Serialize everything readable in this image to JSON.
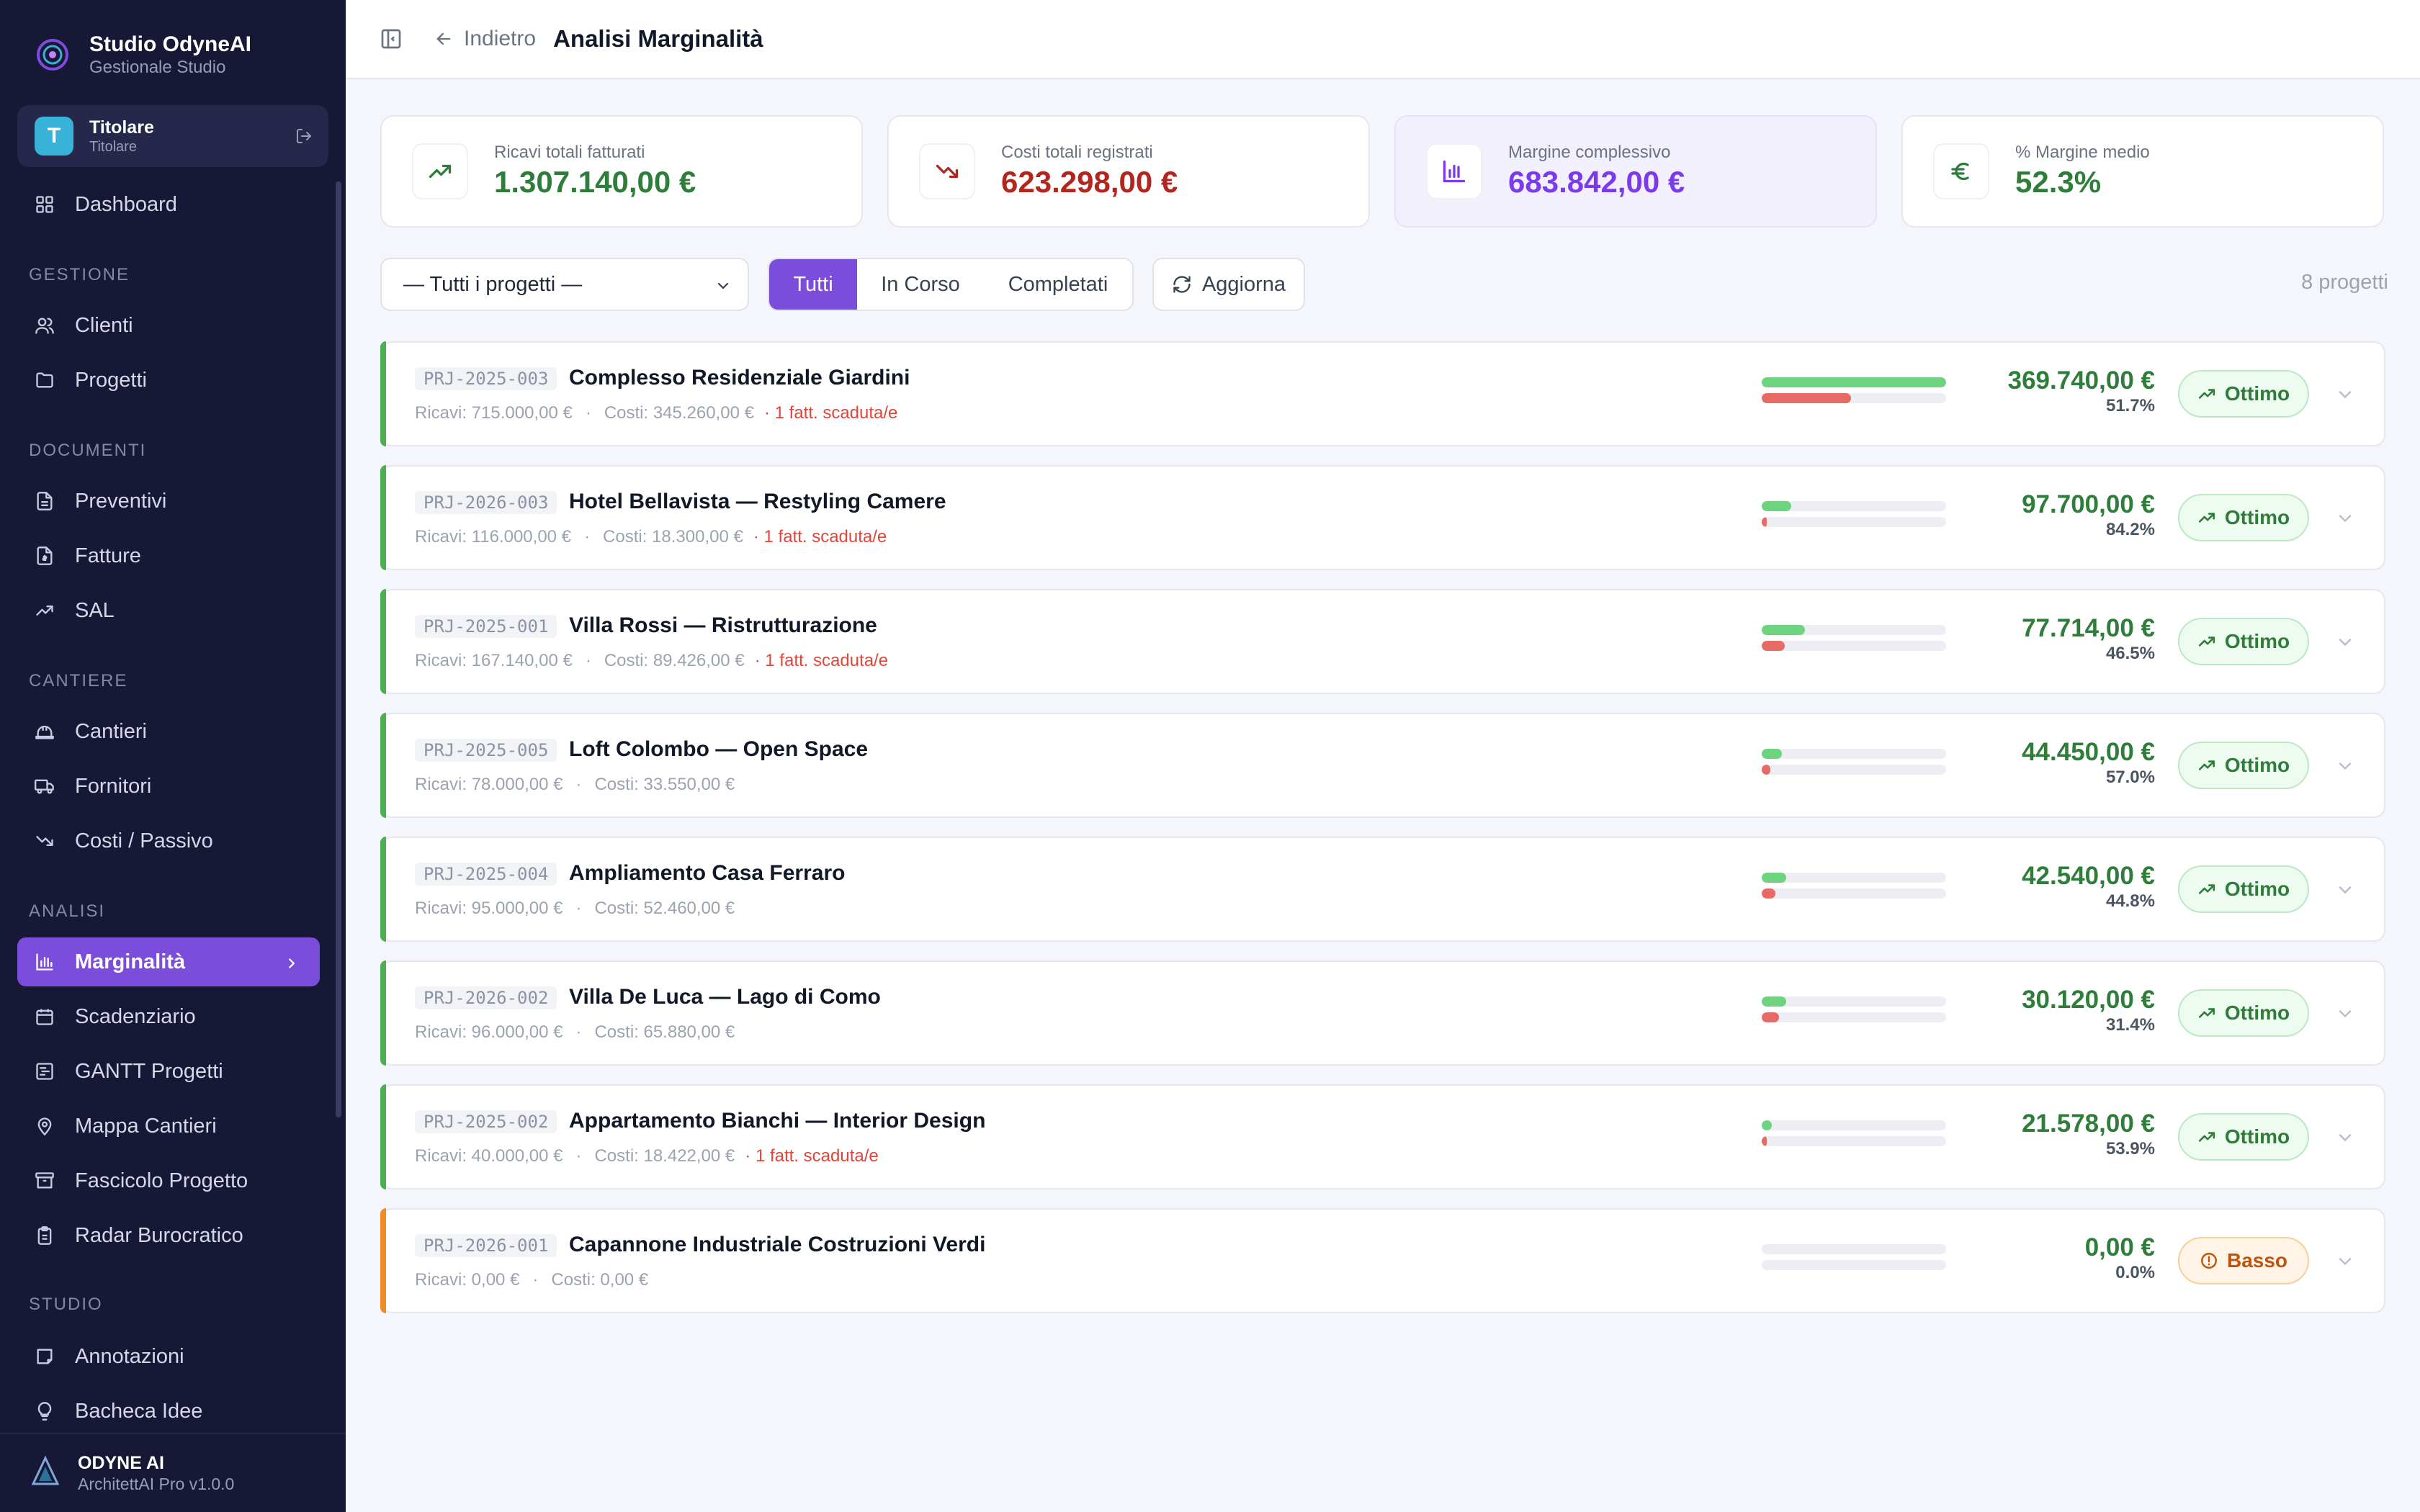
{
  "brand": {
    "title": "Studio OdyneAI",
    "subtitle": "Gestionale Studio"
  },
  "user": {
    "initial": "T",
    "name": "Titolare",
    "role": "Titolare"
  },
  "nav": {
    "dashboard": "Dashboard",
    "sections": {
      "gestione": "GESTIONE",
      "documenti": "DOCUMENTI",
      "cantiere": "CANTIERE",
      "analisi": "ANALISI",
      "studio": "STUDIO"
    },
    "items": {
      "clienti": "Clienti",
      "progetti": "Progetti",
      "preventivi": "Preventivi",
      "fatture": "Fatture",
      "sal": "SAL",
      "cantieri": "Cantieri",
      "fornitori": "Fornitori",
      "costi": "Costi / Passivo",
      "marginalita": "Marginalità",
      "scadenziario": "Scadenziario",
      "gantt": "GANTT Progetti",
      "mappa": "Mappa Cantieri",
      "fascicolo": "Fascicolo Progetto",
      "radar": "Radar Burocratico",
      "annotazioni": "Annotazioni",
      "bacheca": "Bacheca Idee"
    },
    "active": "marginalita"
  },
  "footer": {
    "title": "ODYNE AI",
    "subtitle": "ArchitettAI Pro v1.0.0"
  },
  "header": {
    "back_label": "Indietro",
    "title": "Analisi Marginalità"
  },
  "kpis": [
    {
      "label": "Ricavi totali fatturati",
      "value": "1.307.140,00 €",
      "color": "#2f7d3a",
      "icon": "trending-up-icon"
    },
    {
      "label": "Costi totali registrati",
      "value": "623.298,00 €",
      "color": "#b3261e",
      "icon": "trending-down-icon"
    },
    {
      "label": "Margine complessivo",
      "value": "683.842,00 €",
      "color": "#7c3aed",
      "icon": "bar-chart-icon"
    },
    {
      "label": "% Margine medio",
      "value": "52.3%",
      "color": "#2f7d3a",
      "icon": "euro-icon"
    }
  ],
  "filters": {
    "project_select": "— Tutti i progetti —",
    "tabs": [
      "Tutti",
      "In Corso",
      "Completati"
    ],
    "active_tab": "Tutti",
    "refresh_label": "Aggiorna",
    "count_label": "8 progetti"
  },
  "colors": {
    "accent": "#7c4ddb",
    "good": "#4caf50",
    "warn": "#f08a24",
    "revenue_bar": "#6ed37f",
    "cost_bar": "#e86a64"
  },
  "projects": [
    {
      "code": "PRJ-2025-003",
      "name": "Complesso Residenziale Giardini",
      "ricavi": "Ricavi: 715.000,00 €",
      "costi": "Costi: 345.260,00 €",
      "overdue": "· 1 fatt. scaduta/e",
      "revenue_ratio": 1.0,
      "cost_ratio": 0.483,
      "margin": "369.740,00 €",
      "margin_pct": "51.7%",
      "status": "Ottimo",
      "level": "good"
    },
    {
      "code": "PRJ-2026-003",
      "name": "Hotel Bellavista — Restyling Camere",
      "ricavi": "Ricavi: 116.000,00 €",
      "costi": "Costi: 18.300,00 €",
      "overdue": "· 1 fatt. scaduta/e",
      "revenue_ratio": 0.162,
      "cost_ratio": 0.026,
      "margin": "97.700,00 €",
      "margin_pct": "84.2%",
      "status": "Ottimo",
      "level": "good"
    },
    {
      "code": "PRJ-2025-001",
      "name": "Villa Rossi — Ristrutturazione",
      "ricavi": "Ricavi: 167.140,00 €",
      "costi": "Costi: 89.426,00 €",
      "overdue": "· 1 fatt. scaduta/e",
      "revenue_ratio": 0.234,
      "cost_ratio": 0.125,
      "margin": "77.714,00 €",
      "margin_pct": "46.5%",
      "status": "Ottimo",
      "level": "good"
    },
    {
      "code": "PRJ-2025-005",
      "name": "Loft Colombo — Open Space",
      "ricavi": "Ricavi: 78.000,00 €",
      "costi": "Costi: 33.550,00 €",
      "overdue": "",
      "revenue_ratio": 0.109,
      "cost_ratio": 0.047,
      "margin": "44.450,00 €",
      "margin_pct": "57.0%",
      "status": "Ottimo",
      "level": "good"
    },
    {
      "code": "PRJ-2025-004",
      "name": "Ampliamento Casa Ferraro",
      "ricavi": "Ricavi: 95.000,00 €",
      "costi": "Costi: 52.460,00 €",
      "overdue": "",
      "revenue_ratio": 0.133,
      "cost_ratio": 0.073,
      "margin": "42.540,00 €",
      "margin_pct": "44.8%",
      "status": "Ottimo",
      "level": "good"
    },
    {
      "code": "PRJ-2026-002",
      "name": "Villa De Luca — Lago di Como",
      "ricavi": "Ricavi: 96.000,00 €",
      "costi": "Costi: 65.880,00 €",
      "overdue": "",
      "revenue_ratio": 0.134,
      "cost_ratio": 0.092,
      "margin": "30.120,00 €",
      "margin_pct": "31.4%",
      "status": "Ottimo",
      "level": "good"
    },
    {
      "code": "PRJ-2025-002",
      "name": "Appartamento Bianchi — Interior Design",
      "ricavi": "Ricavi: 40.000,00 €",
      "costi": "Costi: 18.422,00 €",
      "overdue": "· 1 fatt. scaduta/e",
      "revenue_ratio": 0.056,
      "cost_ratio": 0.026,
      "margin": "21.578,00 €",
      "margin_pct": "53.9%",
      "status": "Ottimo",
      "level": "good"
    },
    {
      "code": "PRJ-2026-001",
      "name": "Capannone Industriale Costruzioni Verdi",
      "ricavi": "Ricavi: 0,00 €",
      "costi": "Costi: 0,00 €",
      "overdue": "",
      "revenue_ratio": 0,
      "cost_ratio": 0,
      "margin": "0,00 €",
      "margin_pct": "0.0%",
      "status": "Basso",
      "level": "low"
    }
  ]
}
